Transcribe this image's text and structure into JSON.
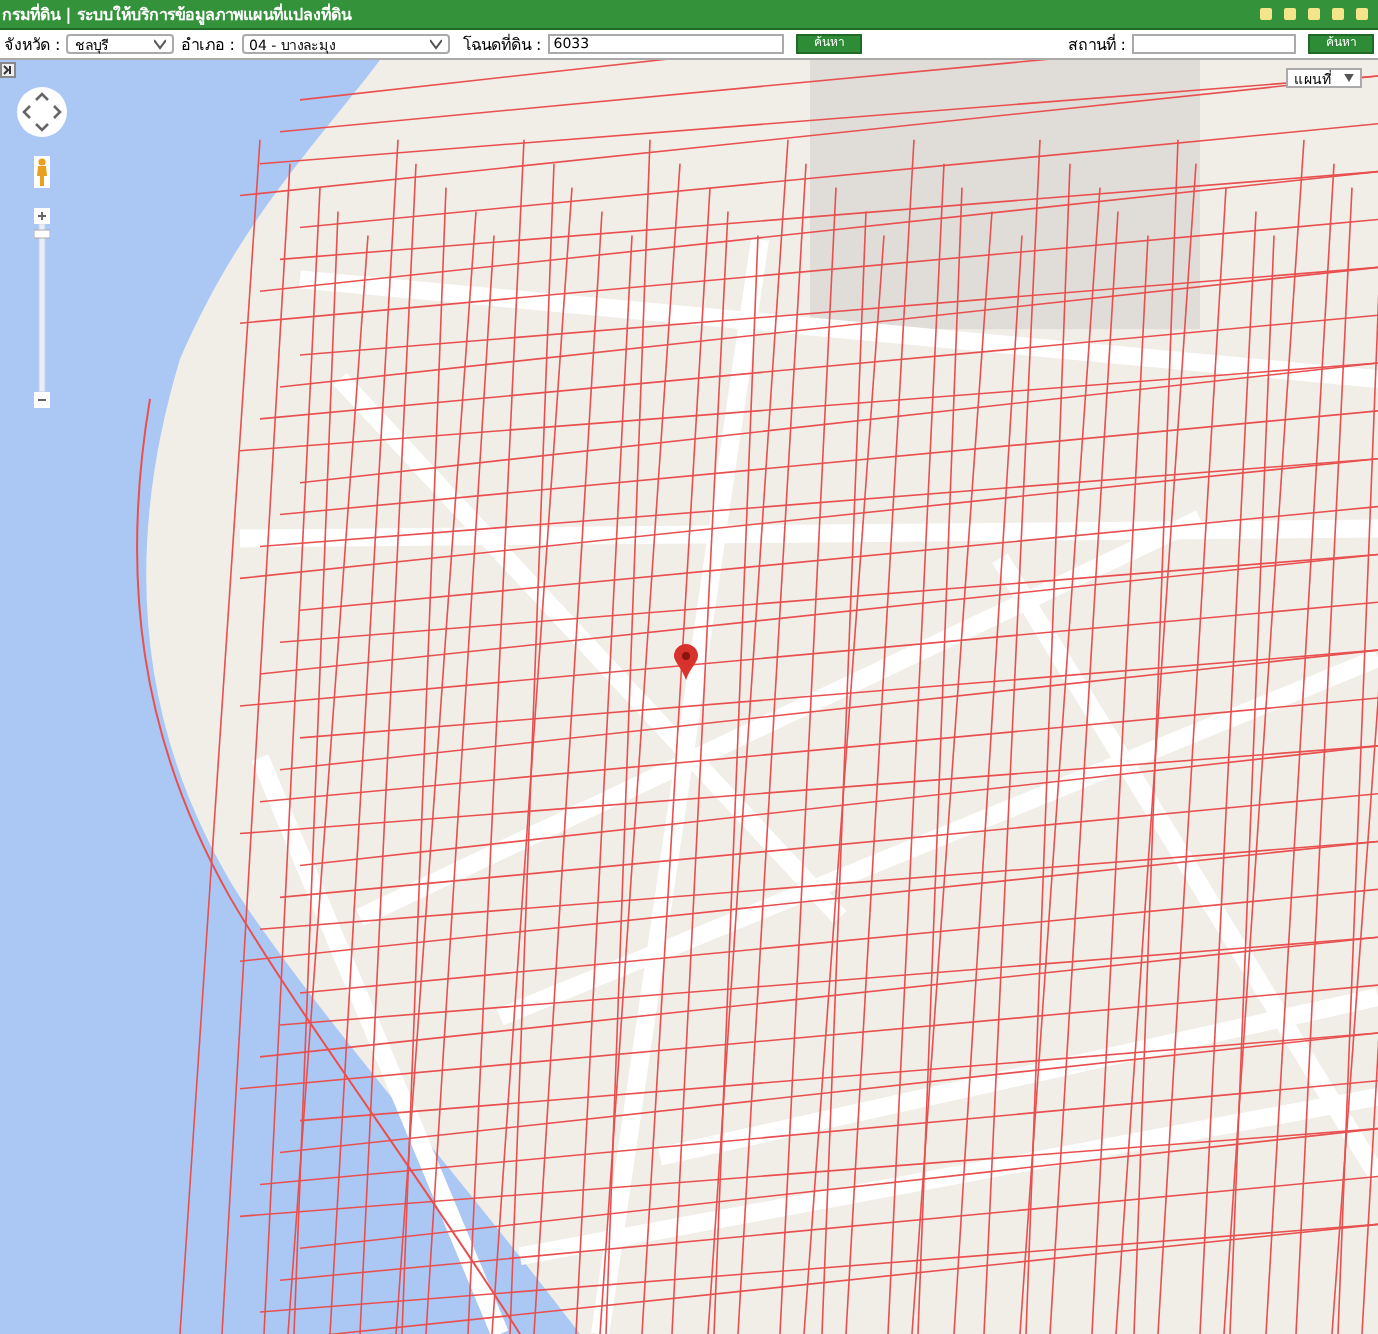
{
  "title_bar": {
    "title": "กรมที่ดิน | ระบบให้บริการข้อมูลภาพแผนที่แปลงที่ดิน"
  },
  "search": {
    "province_label": "จังหวัด :",
    "province": "ชลบุรี",
    "district_label": "อำเภอ :",
    "district": "04 - บางละมุง",
    "deed_label": "โฉนดที่ดิน :",
    "deed": "6033",
    "button": "ค้นหา"
  },
  "place_search": {
    "label": "สถานที่ :",
    "button": "ค้นหา"
  },
  "map": {
    "map_type": "แผนที่"
  }
}
